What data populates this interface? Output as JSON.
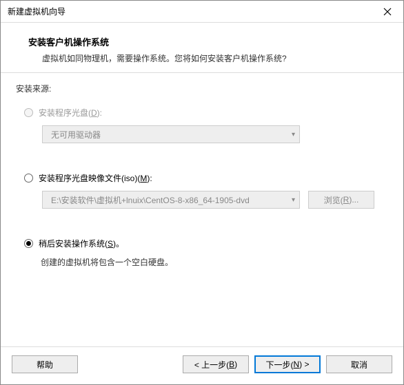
{
  "window": {
    "title": "新建虚拟机向导"
  },
  "header": {
    "heading": "安装客户机操作系统",
    "subheading": "虚拟机如同物理机，需要操作系统。您将如何安装客户机操作系统?"
  },
  "source_label": "安装来源:",
  "options": {
    "disc": {
      "label_pre": "安装程序光盘(",
      "mnemonic": "D",
      "label_post": "):",
      "dropdown_text": "无可用驱动器"
    },
    "iso": {
      "label_pre": "安装程序光盘映像文件(iso)(",
      "mnemonic": "M",
      "label_post": "):",
      "path": "E:\\安装软件\\虚拟机+lnuix\\CentOS-8-x86_64-1905-dvd",
      "browse_pre": "浏览(",
      "browse_mnemonic": "R",
      "browse_post": ")..."
    },
    "later": {
      "label_pre": "稍后安装操作系统(",
      "mnemonic": "S",
      "label_post": ")。",
      "hint": "创建的虚拟机将包含一个空白硬盘。"
    }
  },
  "footer": {
    "help": "帮助",
    "back_pre": "< 上一步(",
    "back_mnemonic": "B",
    "back_post": ")",
    "next_pre": "下一步(",
    "next_mnemonic": "N",
    "next_post": ") >",
    "cancel": "取消"
  }
}
